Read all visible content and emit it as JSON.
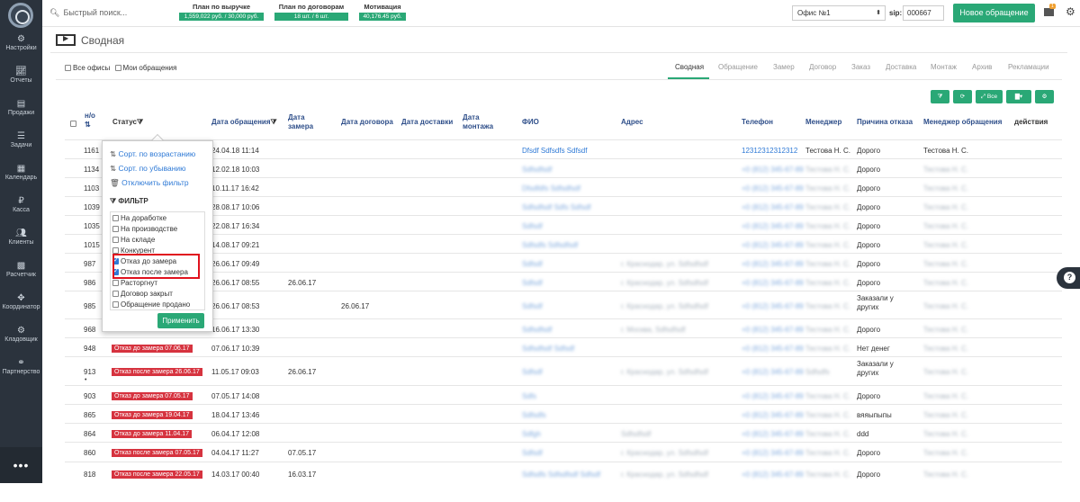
{
  "sidebar": {
    "items": [
      {
        "icon": "gear-icon",
        "label": "Настройки"
      },
      {
        "icon": "chart-icon",
        "label": "Отчеты"
      },
      {
        "icon": "document-icon",
        "label": "Продажи"
      },
      {
        "icon": "tasks-icon",
        "label": "Задачи"
      },
      {
        "icon": "calendar-icon",
        "label": "Календарь"
      },
      {
        "icon": "ruble-icon",
        "label": "Касса"
      },
      {
        "icon": "users-icon",
        "label": "Клиенты"
      },
      {
        "icon": "calculator-icon",
        "label": "Расчетчик"
      },
      {
        "icon": "move-icon",
        "label": "Координатор"
      },
      {
        "icon": "box-icon",
        "label": "Кладовщик"
      },
      {
        "icon": "handshake-icon",
        "label": "Партнерство"
      }
    ],
    "more": "•••"
  },
  "topbar": {
    "search_placeholder": "Быстрый поиск...",
    "plans": [
      {
        "title": "План по выручке",
        "value": "1,559,022 руб. / 30,000 руб."
      },
      {
        "title": "План по договорам",
        "value": "18 шт. / 6 шт."
      },
      {
        "title": "Мотивация",
        "value": "40,176.45 руб."
      }
    ],
    "office": "Офис №1",
    "sip_label": "sip:",
    "sip": "000667",
    "new_button": "Новое обращение",
    "mail_badge": "1"
  },
  "page": {
    "title": "Сводная",
    "all_offices": "Все офисы",
    "my_requests": "Мои обращения"
  },
  "tabs": [
    "Сводная",
    "Обращение",
    "Замер",
    "Договор",
    "Заказ",
    "Доставка",
    "Монтаж",
    "Архив",
    "Рекламации"
  ],
  "toolbar": {
    "all_label": "Все"
  },
  "table": {
    "headers": {
      "num": "н/о",
      "status": "Статус",
      "date_req": "Дата обращения",
      "date_measure": "Дата замера",
      "date_contract": "Дата договора",
      "date_delivery": "Дата доставки",
      "date_install": "Дата монтажа",
      "fio": "ФИО",
      "address": "Адрес",
      "phone": "Телефон",
      "manager": "Менеджер",
      "refusal": "Причина отказа",
      "req_manager": "Менеджер обращения",
      "actions": "действия"
    },
    "rows": [
      {
        "num": "1161",
        "status": "",
        "date_req": "24.04.18 11:14",
        "date_measure": "",
        "date_contract": "",
        "fio": "Dfsdf Sdfsdfs Sdfsdf",
        "address": "",
        "phone": "12312312312312",
        "manager": "Тестова Н. С.",
        "refusal": "Дорого",
        "req_manager": "Тестова Н. С."
      },
      {
        "num": "1134",
        "status": "",
        "date_req": "12.02.18 10:03",
        "date_measure": "",
        "date_contract": "",
        "fio": "Sdfsdfsdf",
        "address": "",
        "phone": "+0 (812) 345-67-89",
        "manager": "Тестова Н. С.",
        "refusal": "Дорого",
        "req_manager": "Тестова Н. С."
      },
      {
        "num": "1103",
        "status": "",
        "date_req": "10.11.17 16:42",
        "date_measure": "",
        "date_contract": "",
        "fio": "Dfsdfdfs Sdfsdfsdf",
        "address": "",
        "phone": "+0 (812) 345-67-89",
        "manager": "Тестова Н. С.",
        "refusal": "Дорого",
        "req_manager": "Тестова Н. С."
      },
      {
        "num": "1039",
        "status": "",
        "date_req": "28.08.17 10:06",
        "date_measure": "",
        "date_contract": "",
        "fio": "Sdfsdfsdf Sdfs Sdfsdf",
        "address": "",
        "phone": "+0 (812) 345-67-89",
        "manager": "Тестова Н. С.",
        "refusal": "Дорого",
        "req_manager": "Тестова Н. С."
      },
      {
        "num": "1035",
        "status": "",
        "date_req": "22.08.17 16:34",
        "date_measure": "",
        "date_contract": "",
        "fio": "Sdfsdf",
        "address": "",
        "phone": "+0 (812) 345-67-89",
        "manager": "Тестова Н. С.",
        "refusal": "Дорого",
        "req_manager": "Тестова Н. С."
      },
      {
        "num": "1015",
        "status": "",
        "date_req": "14.08.17 09:21",
        "date_measure": "",
        "date_contract": "",
        "fio": "Sdfsdfs Sdfsdfsdf",
        "address": "",
        "phone": "+0 (812) 345-67-89",
        "manager": "Тестова Н. С.",
        "refusal": "Дорого",
        "req_manager": "Тестова Н. С."
      },
      {
        "num": "987",
        "status": "",
        "date_req": "26.06.17 09:49",
        "date_measure": "",
        "date_contract": "",
        "fio": "Sdfsdf",
        "address": "г. Краснодар, ул. Sdfsdfsdf",
        "phone": "+0 (812) 345-67-89",
        "manager": "Тестова Н. С.",
        "refusal": "Дорого",
        "req_manager": "Тестова Н. С."
      },
      {
        "num": "986",
        "status": "",
        "date_req": "26.06.17 08:55",
        "date_measure": "26.06.17",
        "date_contract": "",
        "fio": "Sdfsdf",
        "address": "г. Краснодар, ул. Sdfsdfsdf",
        "phone": "+0 (812) 345-67-89",
        "manager": "Тестова Н. С.",
        "refusal": "Дорого",
        "req_manager": "Тестова Н. С."
      },
      {
        "num": "985",
        "status": "",
        "date_req": "26.06.17 08:53",
        "date_measure": "",
        "date_contract": "26.06.17",
        "fio": "Sdfsdf",
        "address": "г. Краснодар, ул. Sdfsdfsdf",
        "phone": "+0 (812) 345-67-89",
        "manager": "Тестова Н. С.",
        "refusal": "Заказали у других",
        "req_manager": "Тестова Н. С."
      },
      {
        "num": "968",
        "status": "",
        "date_req": "16.06.17 13:30",
        "date_measure": "",
        "date_contract": "",
        "fio": "Sdfsdfsdf",
        "address": "г. Москва, Sdfsdfsdf",
        "phone": "+0 (812) 345-67-89",
        "manager": "Тестова Н. С.",
        "refusal": "Дорого",
        "req_manager": "Тестова Н. С."
      },
      {
        "num": "948",
        "status": "Отказ до замера 07.06.17",
        "date_req": "07.06.17 10:39",
        "date_measure": "",
        "date_contract": "",
        "fio": "Sdfsdfsdf Sdfsdf",
        "address": "",
        "phone": "+0 (812) 345-67-89",
        "manager": "Тестова Н. С.",
        "refusal": "Нет денег",
        "req_manager": "Тестова Н. С."
      },
      {
        "num": "913",
        "status": "Отказ после замера 26.06.17",
        "date_req": "11.05.17 09:03",
        "date_measure": "26.06.17",
        "date_contract": "",
        "fio": "Sdfsdf",
        "address": "г. Краснодар, ул. Sdfsdfsdf",
        "phone": "+0 (812) 345-67-89",
        "manager": "Sdfsdfs",
        "refusal": "Заказали у других",
        "req_manager": "Тестова Н. С."
      },
      {
        "num": "903",
        "status": "Отказ до замера 07.05.17",
        "date_req": "07.05.17 14:08",
        "date_measure": "",
        "date_contract": "",
        "fio": "Sdfs",
        "address": "",
        "phone": "+0 (812) 345-67-89",
        "manager": "Тестова Н. С.",
        "refusal": "Дорого",
        "req_manager": "Тестова Н. С."
      },
      {
        "num": "865",
        "status": "Отказ до замера 19.04.17",
        "date_req": "18.04.17 13:46",
        "date_measure": "",
        "date_contract": "",
        "fio": "Sdfsdfs",
        "address": "",
        "phone": "+0 (812) 345-67-89",
        "manager": "Тестова Н. С.",
        "refusal": "вяяыпыпы",
        "req_manager": "Тестова Н. С."
      },
      {
        "num": "864",
        "status": "Отказ до замера 11.04.17",
        "date_req": "06.04.17 12:08",
        "date_measure": "",
        "date_contract": "",
        "fio": "Sdfgh",
        "address": "Sdfsdfsdf",
        "phone": "+0 (812) 345-67-89",
        "manager": "Тестова Н. С.",
        "refusal": "ddd",
        "req_manager": "Тестова Н. С."
      },
      {
        "num": "860",
        "status": "Отказ после замера 07.05.17",
        "date_req": "04.04.17 11:27",
        "date_measure": "07.05.17",
        "date_contract": "",
        "fio": "Sdfsdf",
        "address": "г. Краснодар, ул. Sdfsdfsdf",
        "phone": "+0 (812) 345-67-89",
        "manager": "Тестова Н. С.",
        "refusal": "Дорого",
        "req_manager": "Тестова Н. С."
      },
      {
        "num": "818",
        "status": "Отказ после замера 22.05.17",
        "date_req": "14.03.17 00:40",
        "date_measure": "16.03.17",
        "date_contract": "",
        "fio": "Sdfsdfs Sdfsdfsdf Sdfsdf",
        "address": "г. Краснодар, ул. Sdfsdfsdf",
        "phone": "+0 (812) 345-67-89",
        "manager": "Тестова Н. С.",
        "refusal": "Дорого",
        "req_manager": "Тестова Н. С."
      }
    ]
  },
  "dropdown": {
    "sort_asc": "Сорт. по возрастанию",
    "sort_desc": "Сорт. по убыванию",
    "disable_filter": "Отключить фильтр",
    "filter_head": "ФИЛЬТР",
    "options": [
      {
        "label": "На доработке",
        "checked": false
      },
      {
        "label": "На производстве",
        "checked": false
      },
      {
        "label": "На складе",
        "checked": false
      },
      {
        "label": "Конкурент",
        "checked": false
      },
      {
        "label": "Отказ до замера",
        "checked": true
      },
      {
        "label": "Отказ после замера",
        "checked": true
      },
      {
        "label": "Расторгнут",
        "checked": false
      },
      {
        "label": "Договор закрыт",
        "checked": false
      },
      {
        "label": "Обращение продано",
        "checked": false
      }
    ],
    "apply": "Применить"
  },
  "colors": {
    "accent": "#2aa876",
    "badge": "#d6333f",
    "link": "#2f7ad6",
    "sidebar": "#2b333d",
    "highlight": "#e0121e"
  }
}
